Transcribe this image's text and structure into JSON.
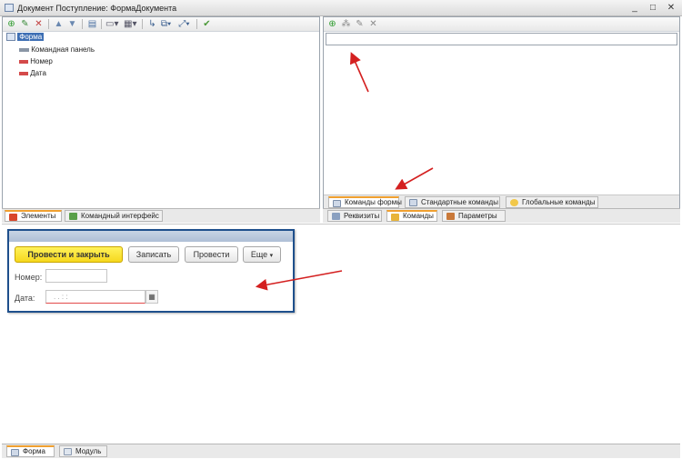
{
  "window": {
    "title": "Документ Поступление: ФормаДокумента"
  },
  "elements_tree": {
    "root": "Форма",
    "items": [
      "Командная панель",
      "Номер",
      "Дата"
    ]
  },
  "left_tabs": [
    {
      "label": "Элементы"
    },
    {
      "label": "Командный интерфейс"
    }
  ],
  "commands_tabs": [
    {
      "label": "Команды формы"
    },
    {
      "label": "Стандартные команды"
    },
    {
      "label": "Глобальные команды"
    }
  ],
  "right_tabs": [
    {
      "label": "Реквизиты"
    },
    {
      "label": "Команды"
    },
    {
      "label": "Параметры"
    }
  ],
  "preview": {
    "buttons": {
      "post_close": "Провести и закрыть",
      "save": "Записать",
      "post": "Провести",
      "more": "Еще"
    },
    "fields": {
      "number_label": "Номер:",
      "date_label": "Дата:",
      "date_mask": ".  .    :  :"
    }
  },
  "bottom_tabs": [
    {
      "label": "Форма"
    },
    {
      "label": "Модуль"
    }
  ],
  "colors": {
    "annotation_arrow": "#d42020",
    "preview_border": "#1e4f8c",
    "primary_button": "#f6d81e"
  }
}
